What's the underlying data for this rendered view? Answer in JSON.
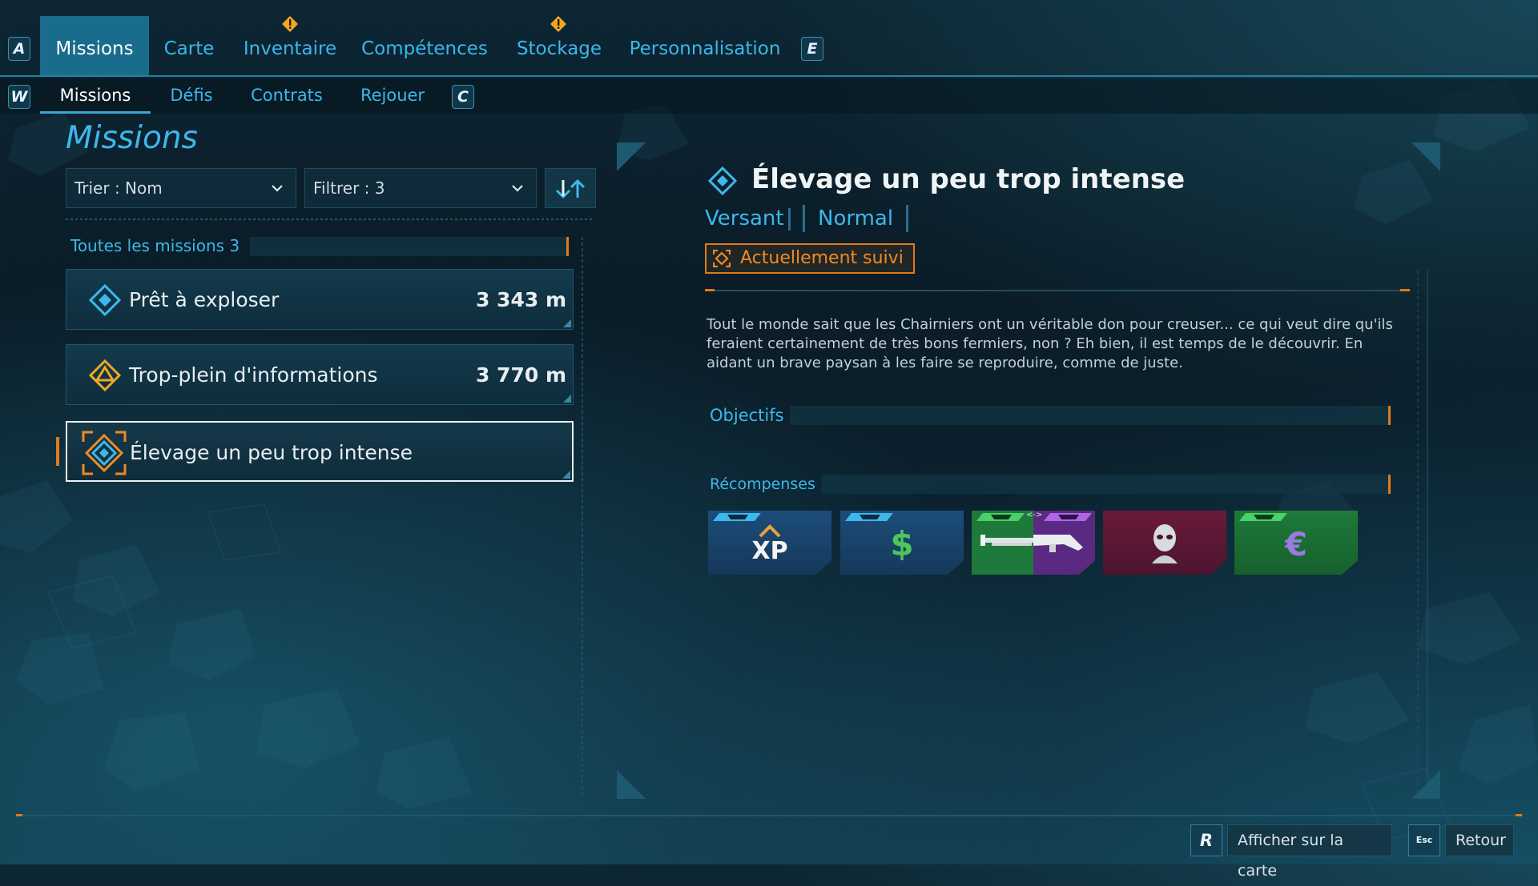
{
  "top_tabs": {
    "left_key": "A",
    "right_key": "E",
    "tabs": [
      {
        "label": "Missions"
      },
      {
        "label": "Carte"
      },
      {
        "label": "Inventaire"
      },
      {
        "label": "Compétences"
      },
      {
        "label": "Stockage"
      },
      {
        "label": "Personnalisation"
      }
    ]
  },
  "sub_tabs": {
    "left_key": "W",
    "right_key": "C",
    "tabs": [
      {
        "label": "Missions"
      },
      {
        "label": "Défis"
      },
      {
        "label": "Contrats"
      },
      {
        "label": "Rejouer"
      }
    ]
  },
  "left_panel": {
    "title": "Missions",
    "sort_label": "Trier : Nom",
    "filter_label": "Filtrer : 3",
    "group_label": "Toutes les missions 3",
    "missions": [
      {
        "name": "Prêt à exploser",
        "distance": "3 343 m"
      },
      {
        "name": "Trop-plein d'informations",
        "distance": "3 770 m"
      },
      {
        "name": "Élevage un peu trop intense",
        "distance": ""
      }
    ]
  },
  "detail": {
    "title": "Élevage un peu trop intense",
    "zone": "Versant",
    "difficulty": "Normal",
    "tracked_label": "Actuellement suivi",
    "description": "Tout le monde sait que les Chairniers ont un véritable don pour creuser... ce qui veut dire qu'ils feraient certainement de très bons fermiers, non ? Eh bien, il est temps de le découvrir. En aidant un brave paysan à les faire se reproduire, comme de juste.",
    "objectives_label": "Objectifs",
    "rewards_label": "Récompenses",
    "rewards": [
      {
        "icon": "xp-icon",
        "text": "XP"
      },
      {
        "icon": "money-icon",
        "text": "$"
      },
      {
        "icon": "shotgun-icon",
        "text": "<->"
      },
      {
        "icon": "head-icon",
        "text": ""
      },
      {
        "icon": "eridium-icon",
        "text": ""
      }
    ]
  },
  "bottom_actions": [
    {
      "key": "R",
      "label": "Afficher sur la carte"
    },
    {
      "key": "Esc",
      "label": "Retour"
    }
  ],
  "colors": {
    "accent": "#3db8ec",
    "tracked": "#e07a1c",
    "active_tab": "#1a6c8c"
  }
}
